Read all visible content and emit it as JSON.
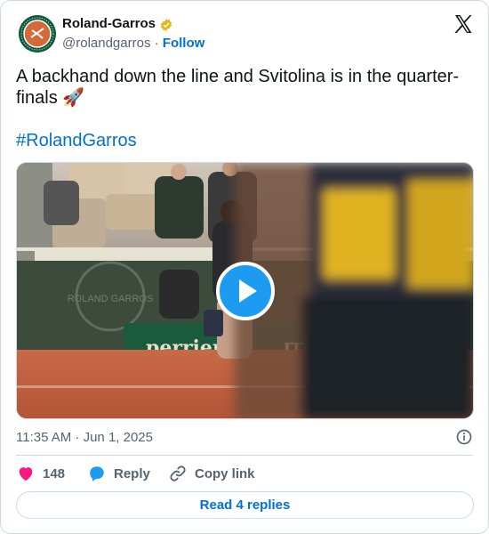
{
  "header": {
    "name": "Roland-Garros",
    "handle": "@rolandgarros",
    "separator": "·",
    "follow_label": "Follow"
  },
  "tweet": {
    "text": "A backhand down the line and Svitolina is in the quarter-finals 🚀",
    "hashtag": "#RolandGarros"
  },
  "media": {
    "sponsor_board": "perrier",
    "sponsor_board_right": "rrier",
    "court_logo": "ROLAND GARROS"
  },
  "meta": {
    "timestamp": "11:35 AM · Jun 1, 2025"
  },
  "actions": {
    "likes": "148",
    "reply_label": "Reply",
    "copy_label": "Copy link"
  },
  "read_replies": "Read 4 replies",
  "colors": {
    "link": "#006fd6",
    "like": "#f91880",
    "reply": "#1d9bf0",
    "clay": "#b9603f"
  }
}
